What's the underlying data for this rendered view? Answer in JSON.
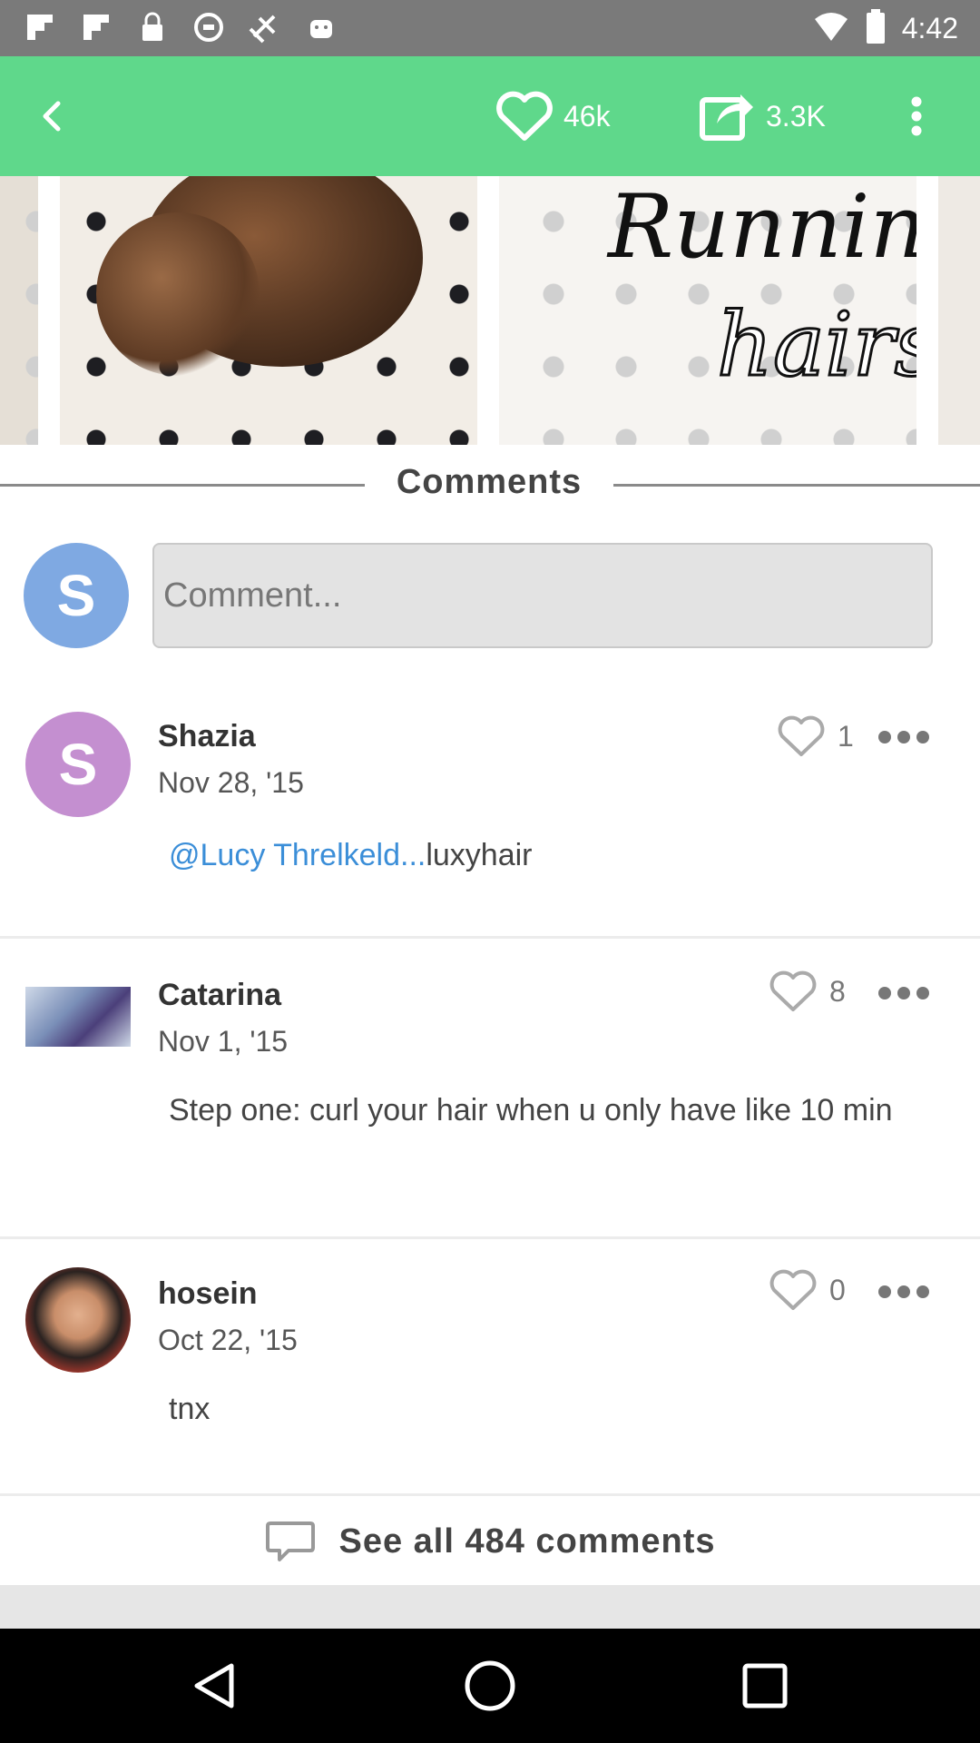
{
  "status_bar": {
    "time": "4:42",
    "icons": [
      "flipboard-icon",
      "flipboard-icon",
      "lock-icon",
      "sync-icon",
      "satellite-icon",
      "android-icon",
      "wifi-icon",
      "battery-icon"
    ]
  },
  "toolbar": {
    "likes_count": "46k",
    "shares_count": "3.3K",
    "accent_color": "#5fd88b"
  },
  "pin_image": {
    "overlay_text_line1": "Running",
    "overlay_text_line2": "hairs"
  },
  "comments_section": {
    "title": "Comments",
    "input": {
      "avatar_letter": "S",
      "placeholder": "Comment..."
    },
    "items": [
      {
        "username": "Shazia",
        "date": "Nov 28, '15",
        "likes": "1",
        "avatar_letter": "S",
        "mention": "@Lucy Threlkeld...",
        "text": "luxyhair"
      },
      {
        "username": "Catarina",
        "date": "Nov 1, '15",
        "likes": "8",
        "text": "Step one: curl your hair when u only have like 10 min"
      },
      {
        "username": "hosein",
        "date": "Oct 22, '15",
        "likes": "0",
        "text": "tnx"
      }
    ],
    "see_all": "See all 484 comments"
  }
}
